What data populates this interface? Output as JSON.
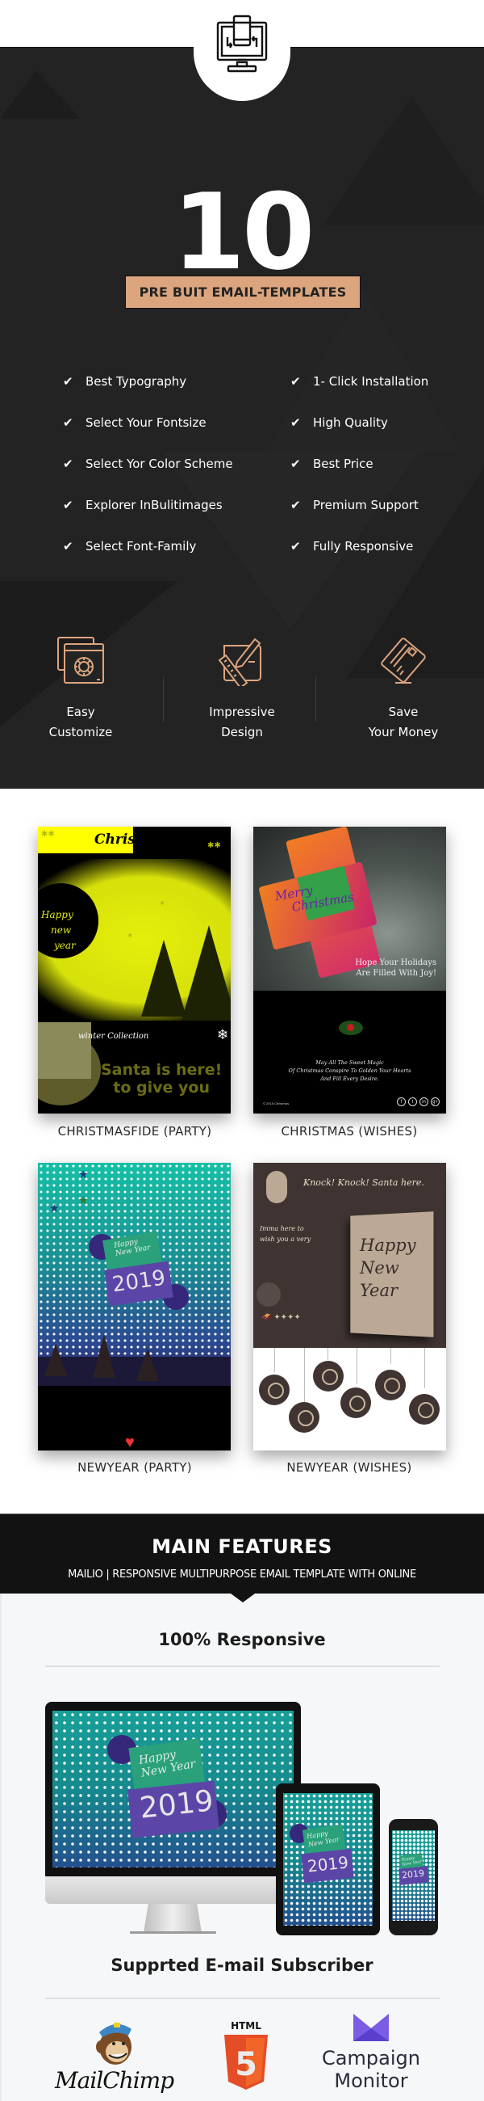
{
  "hero": {
    "top_icon": "responsive-devices-icon",
    "count": "10",
    "badge": "PRE BUIT EMAIL-TEMPLATES",
    "features_left": [
      "Best Typography",
      "Select Your Fontsize",
      "Select Yor Color Scheme",
      "Explorer InBulitimages",
      "Select Font-Family"
    ],
    "features_right": [
      "1- Click Installation",
      "High Quality",
      "Best Price",
      "Premium Support",
      "Fully Responsive"
    ],
    "check_glyph": "✔",
    "pillars": [
      {
        "icon": "settings-window-icon",
        "line1": "Easy",
        "line2": "Customize"
      },
      {
        "icon": "design-pencil-ruler-icon",
        "line1": "Impressive",
        "line2": "Design"
      },
      {
        "icon": "credit-card-icon",
        "line1": "Save",
        "line2": "Your Money"
      }
    ],
    "accent_color": "#dca57e",
    "background_color": "#232323"
  },
  "templates": [
    {
      "caption": "CHRISTMASFIDE (PARTY)",
      "preview": {
        "header": "Christmastide",
        "circle_text": [
          "Happy",
          "new",
          "year"
        ],
        "collection": "winter Collection",
        "promo": [
          "Santa is here!",
          "to give you"
        ]
      }
    },
    {
      "caption": "CHRISTMAS (WISHES)",
      "preview": {
        "card_text": [
          "Merry",
          "Christmas"
        ],
        "headline": [
          "Hope Your Holidays",
          "Are Filled With Joy!"
        ],
        "message": [
          "May All The Sweet Magic",
          "Of Christmas Conspire To Golden Your Hearts",
          "And Fill Every Desire."
        ],
        "footer": "© 2018 Christmas",
        "socials": [
          "f",
          "t",
          "in",
          "g+"
        ]
      }
    },
    {
      "caption": "NEWYEAR (PARTY)",
      "preview": {
        "greeting": [
          "Happy",
          "New Year"
        ],
        "year": "2019"
      }
    },
    {
      "caption": "NEWYEAR (WISHES)",
      "preview": {
        "knock": "Knock! Knock! Santa here.",
        "intro": [
          "Imma here to",
          "wish you a very"
        ],
        "panel": [
          "Happy",
          "New",
          "Year"
        ]
      }
    }
  ],
  "main_features": {
    "title": "MAIN FEATURES",
    "subtitle": "MAILIO | RESPONSIVE MULTIPURPOSE EMAIL TEMPLATE WITH ONLINE",
    "responsive_title": "100% Responsive",
    "devices": {
      "greeting": [
        "Happy",
        "New Year"
      ],
      "year": "2019",
      "apple_glyph": ""
    },
    "subscribers_title": "Supprted E-mail Subscriber",
    "subscribers": [
      {
        "name": "MailChimp",
        "icon": "mailchimp-logo-icon"
      },
      {
        "name": "HTML",
        "icon": "html5-logo-icon",
        "badge_digit": "5"
      },
      {
        "name": "Campaign Monitor",
        "line1": "Campaign",
        "line2": "Monitor",
        "icon": "campaign-monitor-logo-icon"
      }
    ]
  }
}
